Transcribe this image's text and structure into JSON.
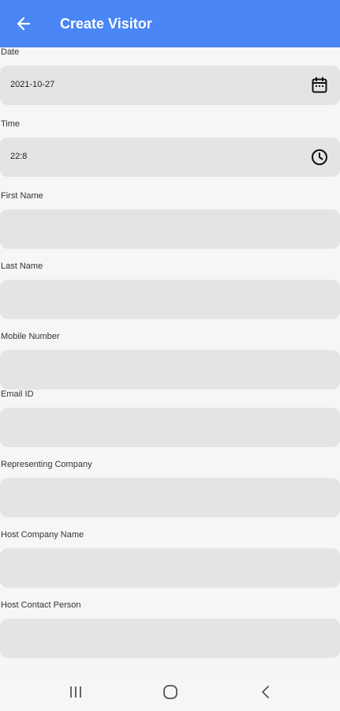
{
  "header": {
    "title": "Create Visitor",
    "back_icon": "arrow-left-icon",
    "background": "#4a86f5"
  },
  "form": {
    "date": {
      "label": "Date",
      "value": "2021-10-27",
      "icon": "calendar-icon"
    },
    "time": {
      "label": "Time",
      "value": "22:8",
      "icon": "clock-icon"
    },
    "first_name": {
      "label": "First Name",
      "value": ""
    },
    "last_name": {
      "label": "Last Name",
      "value": ""
    },
    "mobile_number": {
      "label": "Mobile Number",
      "value": ""
    },
    "email_id": {
      "label": "Email ID",
      "value": ""
    },
    "representing_company": {
      "label": "Representing Company",
      "value": ""
    },
    "host_company_name": {
      "label": "Host Company Name",
      "value": ""
    },
    "host_contact_person": {
      "label": "Host Contact Person",
      "value": ""
    }
  },
  "navigation_bar": {
    "recents_icon": "recents-icon",
    "home_icon": "home-icon",
    "back_icon": "back-chevron-icon"
  }
}
